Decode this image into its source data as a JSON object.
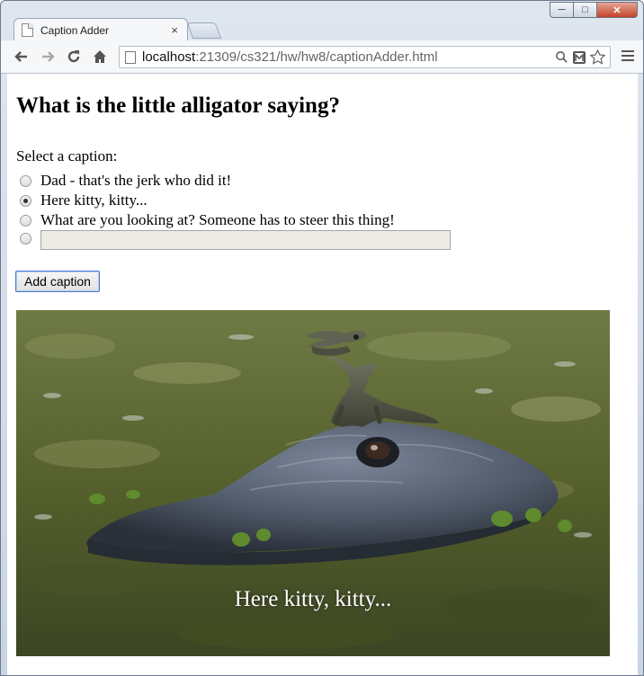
{
  "browser": {
    "tab_title": "Caption Adder",
    "tab_close": "×",
    "url_host": "localhost",
    "url_rest": ":21309/cs321/hw/hw8/captionAdder.html"
  },
  "page": {
    "heading": "What is the little alligator saying?",
    "select_label": "Select a caption:",
    "options": [
      {
        "label": "Dad - that's the jerk who did it!",
        "checked": false
      },
      {
        "label": "Here kitty, kitty...",
        "checked": true
      },
      {
        "label": "What are you looking at? Someone has to steer this thing!",
        "checked": false
      }
    ],
    "custom_caption": {
      "value": "",
      "checked": false
    },
    "add_button": "Add caption",
    "photo_caption": "Here kitty, kitty..."
  }
}
